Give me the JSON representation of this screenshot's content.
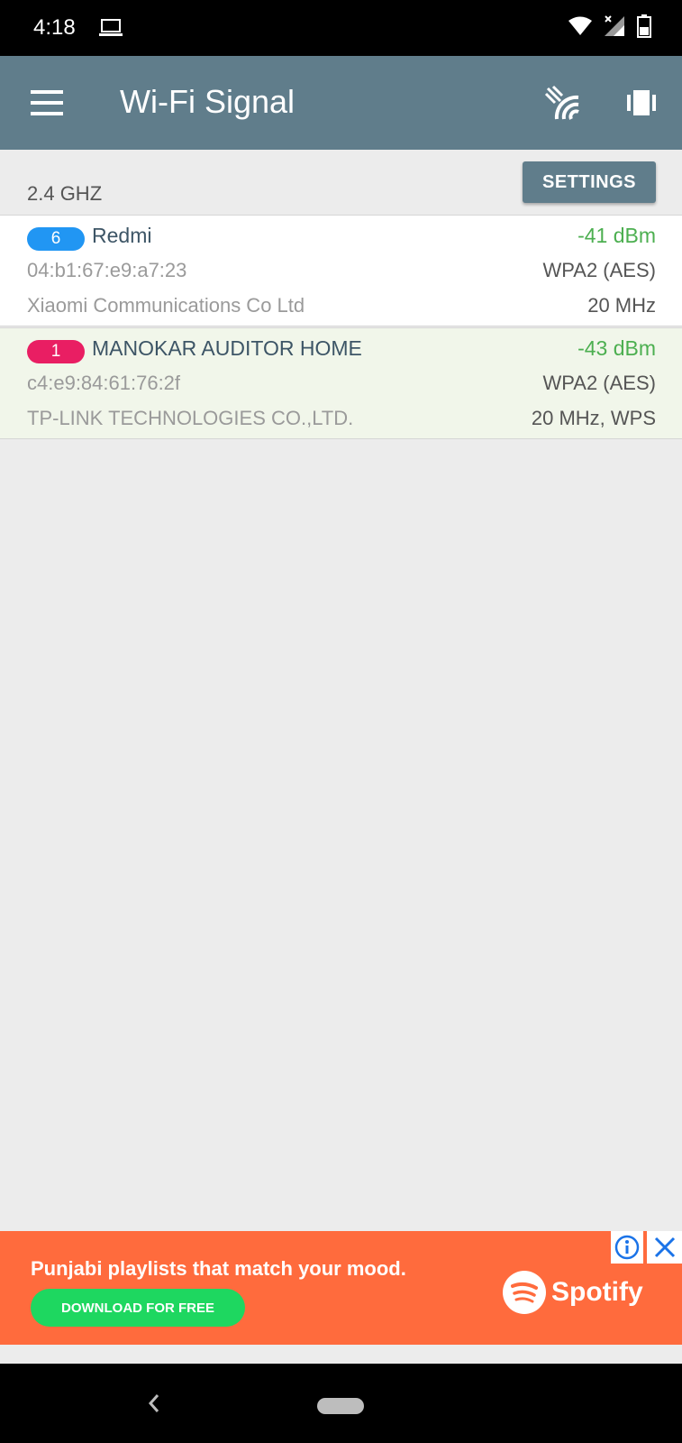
{
  "status_bar": {
    "time": "4:18"
  },
  "app_bar": {
    "title": "Wi-Fi Signal"
  },
  "band": {
    "label": "2.4 GHZ",
    "settings_label": "SETTINGS"
  },
  "networks": [
    {
      "channel": "6",
      "channel_color": "#2196f3",
      "ssid": "Redmi",
      "signal": "-41 dBm",
      "mac": "04:b1:67:e9:a7:23",
      "security": "WPA2 (AES)",
      "vendor": "Xiaomi Communications Co Ltd",
      "width": "20 MHz"
    },
    {
      "channel": "1",
      "channel_color": "#e91e63",
      "ssid": "MANOKAR AUDITOR HOME",
      "signal": "-43 dBm",
      "mac": "c4:e9:84:61:76:2f",
      "security": "WPA2 (AES)",
      "vendor": "TP-LINK TECHNOLOGIES CO.,LTD.",
      "width": "20 MHz, WPS"
    }
  ],
  "ad": {
    "headline": "Punjabi playlists that match your mood.",
    "cta": "DOWNLOAD FOR FREE",
    "brand": "Spotify"
  },
  "colors": {
    "app_bar": "#607d8b",
    "signal_good": "#4caf50",
    "ad_background": "#ff6b3d",
    "ad_cta": "#1ed760"
  }
}
